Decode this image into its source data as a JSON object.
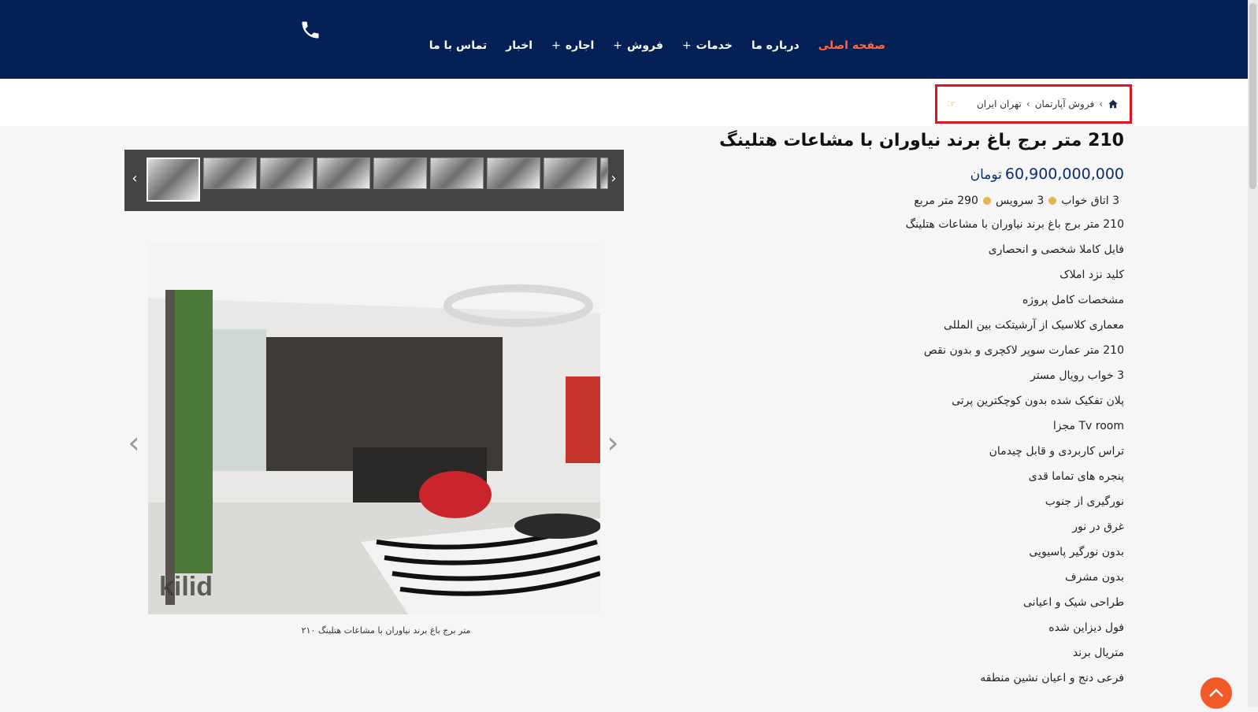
{
  "nav": {
    "items": [
      {
        "label": "صفحه اصلی",
        "active": true,
        "has_submenu": false
      },
      {
        "label": "درباره ما",
        "active": false,
        "has_submenu": false
      },
      {
        "label": "خدمات",
        "active": false,
        "has_submenu": true
      },
      {
        "label": "فروش",
        "active": false,
        "has_submenu": true
      },
      {
        "label": "اجاره",
        "active": false,
        "has_submenu": true
      },
      {
        "label": "اخبار",
        "active": false,
        "has_submenu": false
      },
      {
        "label": "تماس با ما",
        "active": false,
        "has_submenu": false
      }
    ],
    "plus": "+"
  },
  "breadcrumb": {
    "items": [
      "فروش آپارتمان",
      "تهران ایران"
    ],
    "separator": "›"
  },
  "listing": {
    "title": "210 متر برج باغ برند نیاوران با مشاعات هتلینگ",
    "price": "60,900,000,000",
    "currency": "تومان",
    "specs": {
      "bedrooms": "3 اتاق خواب",
      "bathrooms": "3 سرویس",
      "area": "290 متر مربع"
    },
    "features": [
      "210 متر برج باغ برند نیاوران با مشاعات هتلینگ",
      "فایل کاملا شخصی و انحصاری",
      "کلید نزد املاک",
      "مشخصات کامل پروژه",
      "معماری کلاسیک از آرشیتکت بین المللی",
      "210 متر عمارت سوپر لاکچری و بدون نقص",
      "3 خواب رویال مستر",
      "پلان تفکیک شده بدون کوچکترین پرتی",
      "Tv room مجزا",
      "تراس کاربردی و قابل چیدمان",
      "پنجره های تماما قدی",
      "نورگیری از جنوب",
      "غرق در نور",
      "بدون نورگیر پاسیویی",
      "بدون مشرف",
      "طراحی شیک و اعیانی",
      "فول دیزاین شده",
      "متریال برند",
      "فرعی دنج و اعیان نشین منطقه"
    ]
  },
  "gallery": {
    "caption": "متر برج باغ برند نیاوران با مشاعات هتلینگ ۲۱۰",
    "watermark": "kilid",
    "thumb_count": 9,
    "selected_index": 0,
    "prev_glyph": "‹",
    "next_glyph": "›"
  },
  "colors": {
    "header_bg": "#042055",
    "nav_active": "#ff6a3d",
    "price": "#0b2d6e",
    "spec_dot": "#e3b64c",
    "highlight_border": "#e0141e",
    "scroll_top_bg": "#f25a28"
  },
  "icons": {
    "phone": "phone-icon",
    "home": "home-icon",
    "hand": "hand-pointing-icon",
    "scroll_top": "chevron-up-icon"
  }
}
